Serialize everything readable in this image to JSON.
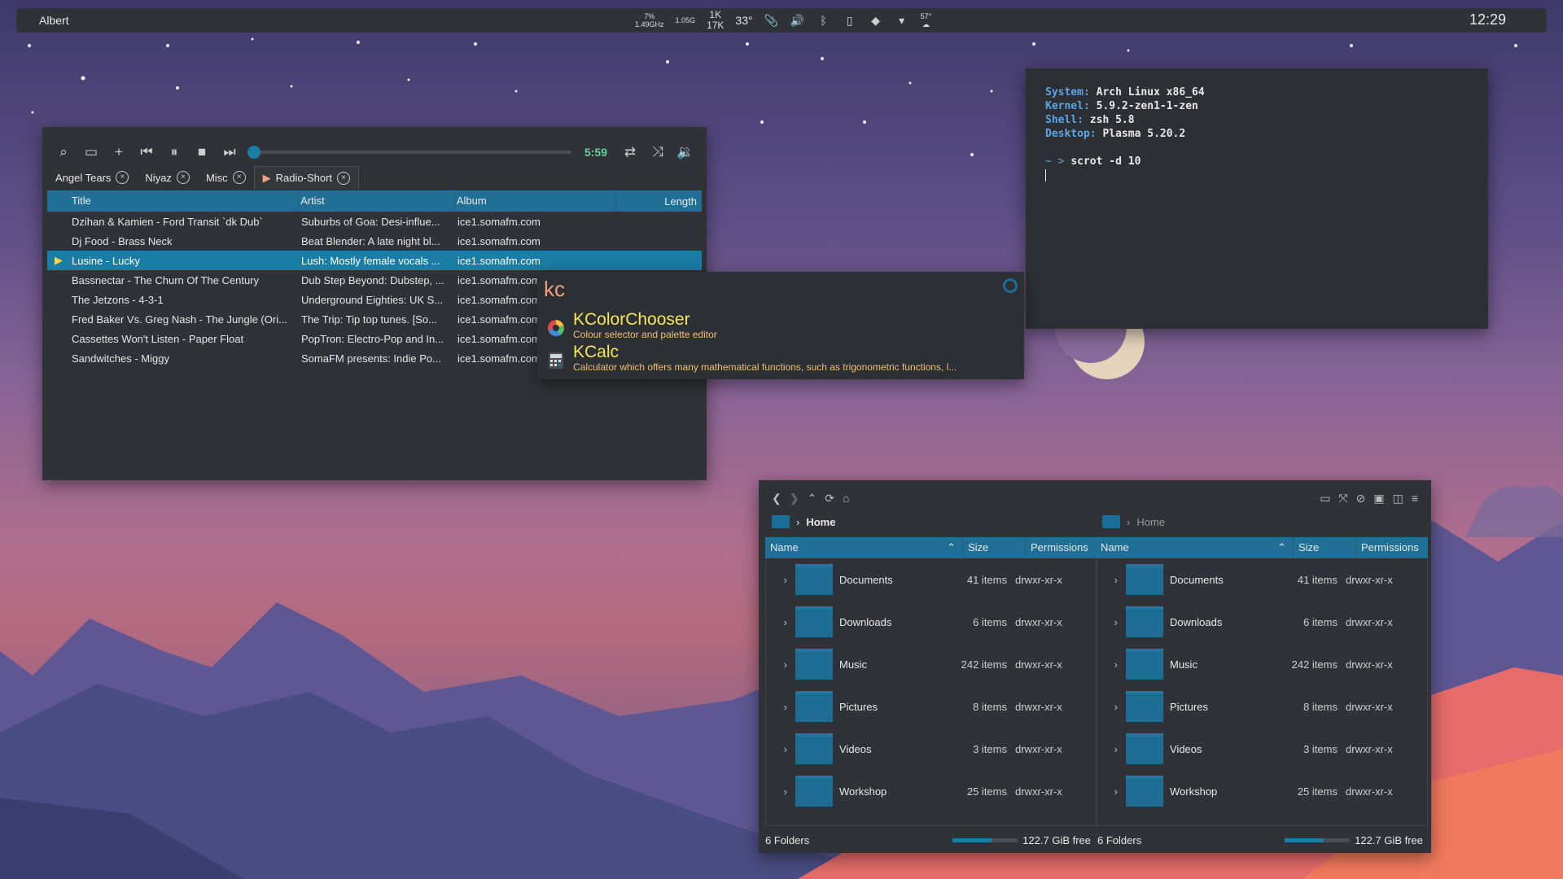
{
  "panel": {
    "app_label": "Albert",
    "cpu": "7%",
    "freq": "1.49GHz",
    "mem": "1.05G",
    "net_up": "1K",
    "net_down": "17K",
    "temp": "33°",
    "weather_temp": "57°",
    "clock": "12:29"
  },
  "player": {
    "time": "5:59",
    "tabs": [
      "Angel Tears",
      "Niyaz",
      "Misc",
      "Radio-Short"
    ],
    "columns": [
      "Title",
      "Artist",
      "Album",
      "Length"
    ],
    "rows": [
      {
        "title": "Dzihan & Kamien - Ford Transit `dk Dub`",
        "artist": "Suburbs of Goa: Desi-influe...",
        "album": "ice1.somafm.com"
      },
      {
        "title": "Dj Food - Brass Neck",
        "artist": "Beat Blender: A late night bl...",
        "album": "ice1.somafm.com"
      },
      {
        "title": "Lusine - Lucky",
        "artist": "Lush: Mostly female vocals ...",
        "album": "ice1.somafm.com"
      },
      {
        "title": "Bassnectar - The Churn Of The Century",
        "artist": "Dub Step Beyond: Dubstep, ...",
        "album": "ice1.somafm.com"
      },
      {
        "title": "The Jetzons - 4-3-1",
        "artist": "Underground Eighties: UK S...",
        "album": "ice1.somafm.com"
      },
      {
        "title": "Fred Baker Vs. Greg Nash - The Jungle (Ori...",
        "artist": "The Trip: Tip top tunes. [So...",
        "album": "ice1.somafm.com"
      },
      {
        "title": "Cassettes Won't Listen - Paper Float",
        "artist": "PopTron: Electro-Pop and In...",
        "album": "ice1.somafm.com"
      },
      {
        "title": "Sandwitches - Miggy",
        "artist": "SomaFM presents: Indie Po...",
        "album": "ice1.somafm.com"
      }
    ]
  },
  "launcher": {
    "query": "kc",
    "items": [
      {
        "title": "KColorChooser",
        "desc": "Colour selector and palette editor"
      },
      {
        "title": "KCalc",
        "desc": "Calculator which offers many mathematical functions, such as trigonometric functions, l..."
      }
    ]
  },
  "terminal": {
    "info": [
      {
        "key": "System",
        "value": "Arch Linux x86_64"
      },
      {
        "key": "Kernel",
        "value": "5.9.2-zen1-1-zen"
      },
      {
        "key": "Shell",
        "value": "zsh 5.8"
      },
      {
        "key": "Desktop",
        "value": "Plasma 5.20.2"
      }
    ],
    "prompt": "~ >",
    "command": "scrot -d 10"
  },
  "filemanager": {
    "breadcrumb": "Home",
    "columns": [
      "Name",
      "Size",
      "Permissions"
    ],
    "folders": [
      {
        "name": "Documents",
        "size": "41 items",
        "perm": "drwxr-xr-x"
      },
      {
        "name": "Downloads",
        "size": "6 items",
        "perm": "drwxr-xr-x"
      },
      {
        "name": "Music",
        "size": "242 items",
        "perm": "drwxr-xr-x"
      },
      {
        "name": "Pictures",
        "size": "8 items",
        "perm": "drwxr-xr-x"
      },
      {
        "name": "Videos",
        "size": "3 items",
        "perm": "drwxr-xr-x"
      },
      {
        "name": "Workshop",
        "size": "25 items",
        "perm": "drwxr-xr-x"
      }
    ],
    "status_count": "6 Folders",
    "status_free": "122.7 GiB free"
  }
}
